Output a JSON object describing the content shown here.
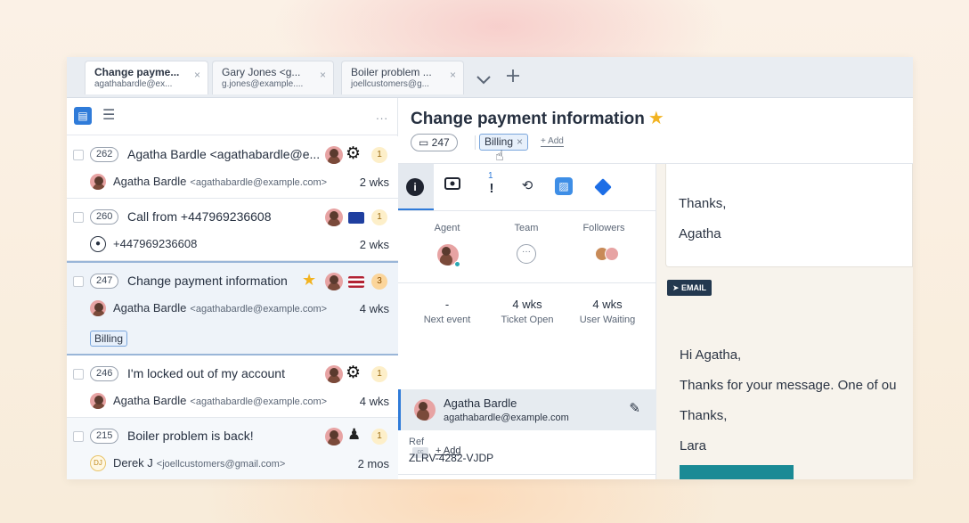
{
  "tabs": [
    {
      "title": "Change payme...",
      "sub": "agathabardle@ex..."
    },
    {
      "title": "Gary Jones <g...",
      "sub": "g.jones@example...."
    },
    {
      "title": "Boiler problem ...",
      "sub": "joellcustomers@g..."
    }
  ],
  "tab_close_glyph": "×",
  "tab_overflow_icon": "chevron-down-icon",
  "tab_add_icon": "plus-icon",
  "list": {
    "more": "...",
    "rows": [
      {
        "id": "262",
        "title": "Agatha Bardle <agathabardle@e...",
        "count": "1",
        "from": "Agatha Bardle",
        "email": "<agathabardle@example.com>",
        "time": "2 wks"
      },
      {
        "id": "260",
        "title": "Call from +447969236608",
        "count": "1",
        "from": "+447969236608",
        "email": "",
        "time": "2 wks"
      },
      {
        "id": "247",
        "title": "Change payment information",
        "count": "3",
        "from": "Agatha Bardle",
        "email": "<agathabardle@example.com>",
        "time": "4 wks",
        "label": "Billing"
      },
      {
        "id": "246",
        "title": "I'm locked out of my account",
        "count": "1",
        "from": "Agatha Bardle",
        "email": "<agathabardle@example.com>",
        "time": "4 wks"
      },
      {
        "id": "215",
        "title": "Boiler problem is back!",
        "count": "1",
        "from": "Derek J",
        "email": "<joellcustomers@gmail.com>",
        "time": "2 mos",
        "initials": "DJ"
      }
    ]
  },
  "ticket": {
    "title": "Change payment information",
    "id": "247",
    "label": "Billing",
    "add_label": "+ Add"
  },
  "info": {
    "tab_badge": "1",
    "agent_label": "Agent",
    "team_label": "Team",
    "followers_label": "Followers",
    "next_event_value": "-",
    "next_event_label": "Next event",
    "ticket_open_value": "4 wks",
    "ticket_open_label": "Ticket Open",
    "user_waiting_value": "4 wks",
    "user_waiting_label": "User Waiting",
    "contact_name": "Agatha Bardle",
    "contact_email": "agathabardle@example.com",
    "cc_label": "cc",
    "cc_add": "+ Add",
    "ref_label": "Ref",
    "ref_value": "ZLRV-4282-VJDP"
  },
  "messages": {
    "card_line1": "Thanks,",
    "card_line2": "Agatha",
    "email_badge": "EMAIL",
    "line1": "Hi Agatha,",
    "line2": "Thanks for your message. One of ou",
    "line3": "Thanks,",
    "line4": "Lara"
  },
  "colors": {
    "accent": "#2f7bd9",
    "star": "#f2b321",
    "email_badge": "#23384f",
    "teal": "#1a8a95"
  }
}
